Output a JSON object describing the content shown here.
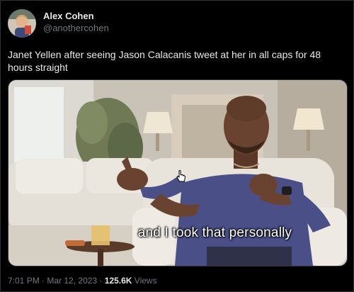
{
  "author": {
    "display_name": "Alex Cohen",
    "handle": "@anothercohen",
    "avatar_icon": "avatar-photo"
  },
  "tweet": {
    "text": "Janet Yellen after seeing Jason Calacanis tweet at her in all caps for 48 hours straight"
  },
  "media": {
    "caption": "and I took that personally",
    "cursor_icon": "hand-pointer-icon"
  },
  "meta": {
    "time": "7:01 PM",
    "sep1": " · ",
    "date": "Mar 12, 2023",
    "sep2": " · ",
    "views_count": "125.6K",
    "views_label": " Views"
  }
}
